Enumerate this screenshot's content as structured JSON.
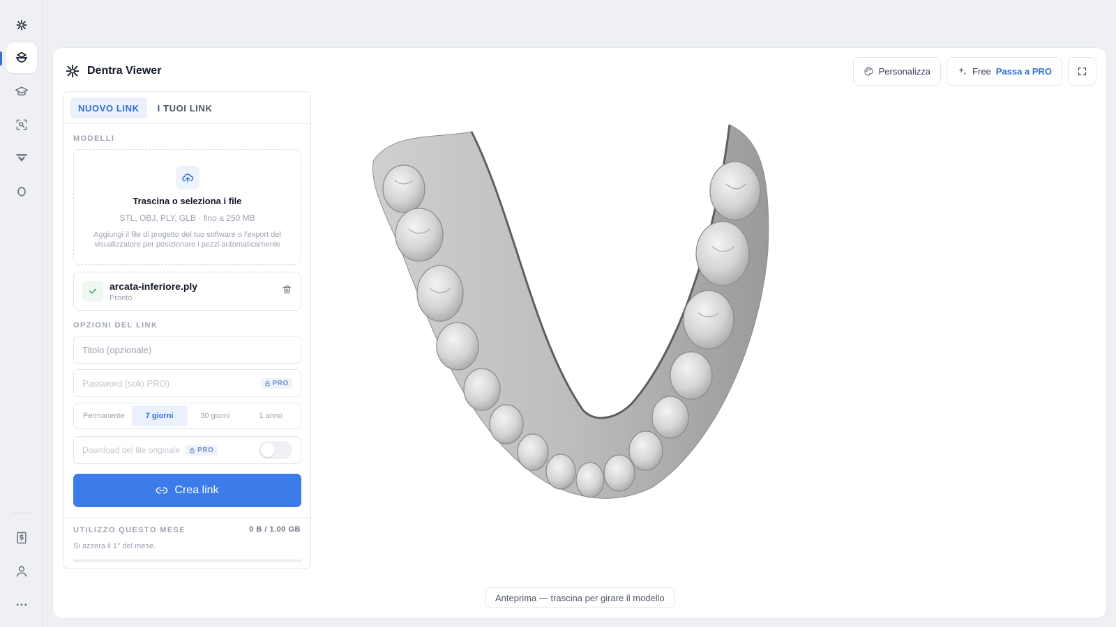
{
  "app": {
    "title": "Dentra Viewer"
  },
  "rail": {
    "items": [
      {
        "icon": "logo-mark-icon"
      },
      {
        "icon": "viewer-icon",
        "active": true
      },
      {
        "icon": "graduation-cap-icon"
      },
      {
        "icon": "scan-search-icon"
      },
      {
        "icon": "wing-icon"
      },
      {
        "icon": "ring-icon"
      }
    ],
    "bottom": [
      {
        "icon": "billing-icon"
      },
      {
        "icon": "user-icon"
      },
      {
        "icon": "more-icon"
      }
    ]
  },
  "header": {
    "personalize_label": "Personalizza",
    "plan_label": "Free",
    "upgrade_label": "Passa a PRO"
  },
  "panel": {
    "tabs": [
      {
        "label": "NUOVO LINK",
        "active": true
      },
      {
        "label": "I TUOI LINK",
        "active": false
      }
    ],
    "models_label": "MODELLI",
    "dropzone": {
      "title": "Trascina o seleziona i file",
      "formats": "STL, OBJ, PLY, GLB · fino a 250 MB",
      "help": "Aggiungi il file di progetto del tuo software o l'export del visualizzatore per posizionare i pezzi automaticamente"
    },
    "file": {
      "name": "arcata-inferiore.ply",
      "status": "Pronto"
    },
    "options_label": "OPZIONI DEL LINK",
    "title_placeholder": "Titolo (opzionale)",
    "password_placeholder": "Password (solo PRO)",
    "pro_badge": "PRO",
    "durations": [
      {
        "label": "Permanente",
        "active": false
      },
      {
        "label": "7 giorni",
        "active": true
      },
      {
        "label": "30 giorni",
        "active": false
      },
      {
        "label": "1 anno",
        "active": false
      }
    ],
    "download_label": "Download del file originale",
    "download_enabled": false,
    "create_label": "Crea link",
    "usage": {
      "label": "UTILIZZO QUESTO MESE",
      "value": "0 B / 1.00 GB",
      "note": "Si azzera il 1° del mese.",
      "fraction": 0
    }
  },
  "preview": {
    "hint": "Anteprima — trascina per girare il modello"
  },
  "colors": {
    "accent": "#3b7bea",
    "accent_text": "#2f6fd6",
    "background": "#eef0f4",
    "success": "#22a05a"
  }
}
